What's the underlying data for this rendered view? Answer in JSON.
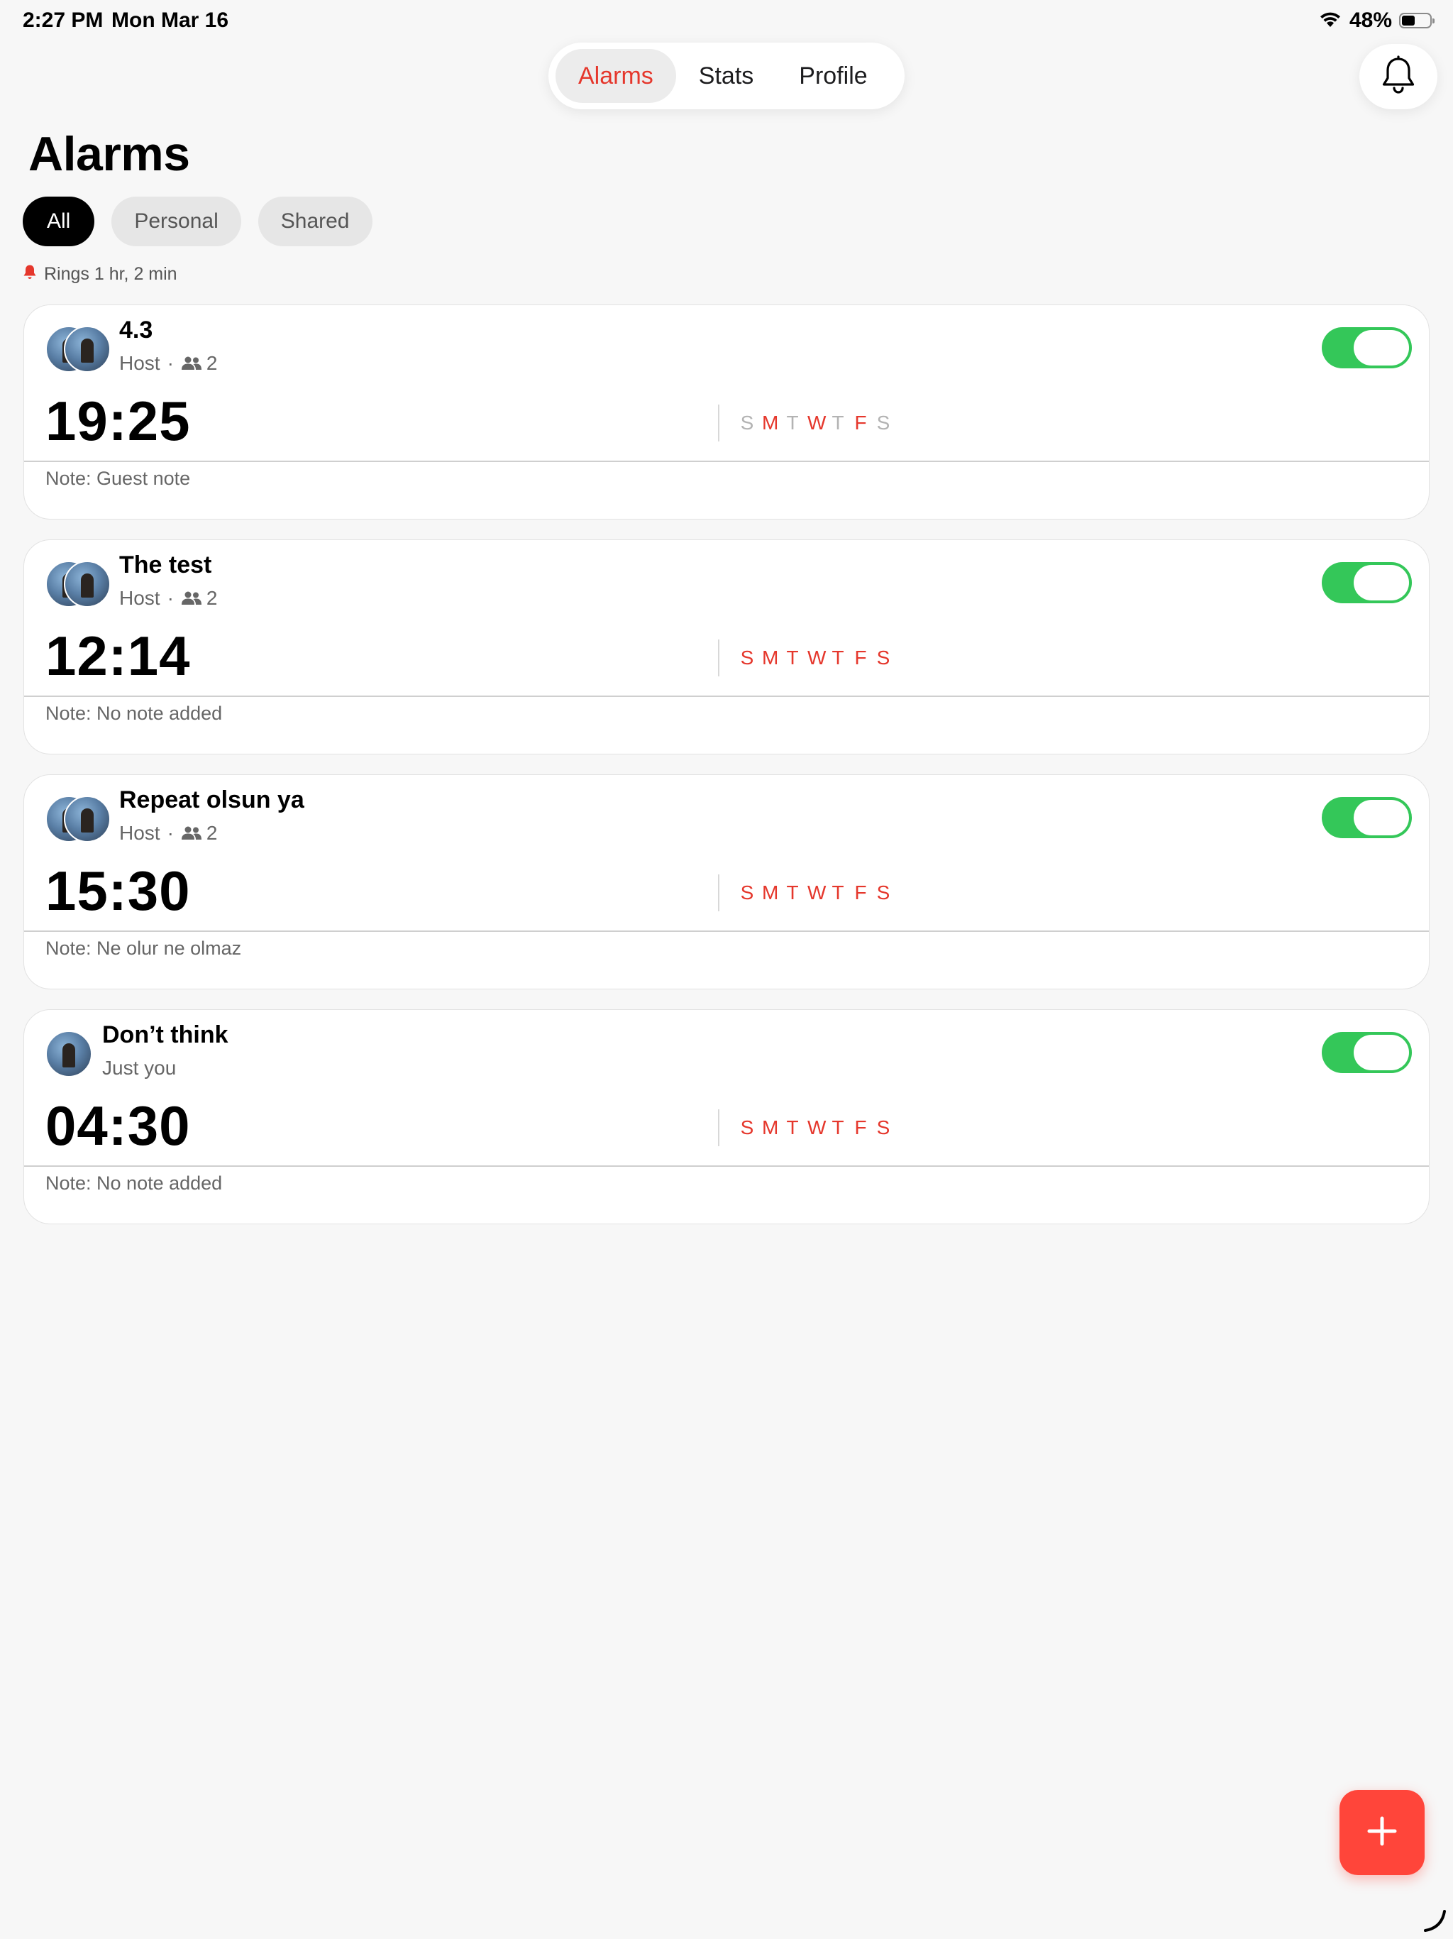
{
  "status_bar": {
    "time": "2:27 PM",
    "date": "Mon Mar 16",
    "battery_pct": "48%",
    "battery_level": 0.48
  },
  "tabs": [
    {
      "label": "Alarms",
      "active": true
    },
    {
      "label": "Stats",
      "active": false
    },
    {
      "label": "Profile",
      "active": false
    }
  ],
  "page_title": "Alarms",
  "filters": [
    {
      "label": "All",
      "active": true
    },
    {
      "label": "Personal",
      "active": false
    },
    {
      "label": "Shared",
      "active": false
    }
  ],
  "next_ring": "Rings 1 hr, 2 min",
  "colors": {
    "accent": "#e5372c",
    "toggle_on": "#34c759",
    "fab": "#ff453a"
  },
  "alarms": [
    {
      "title": "4.3",
      "role": "Host",
      "member_count": "2",
      "time": "19:25",
      "enabled": true,
      "days": [
        {
          "letter": "S",
          "on": false
        },
        {
          "letter": "M",
          "on": true
        },
        {
          "letter": "T",
          "on": false
        },
        {
          "letter": "W",
          "on": true
        },
        {
          "letter": "T",
          "on": false
        },
        {
          "letter": "F",
          "on": true
        },
        {
          "letter": "S",
          "on": false
        }
      ],
      "note": "Note: Guest note"
    },
    {
      "title": "The test",
      "role": "Host",
      "member_count": "2",
      "time": "12:14",
      "enabled": true,
      "days": [
        {
          "letter": "S",
          "on": true
        },
        {
          "letter": "M",
          "on": true
        },
        {
          "letter": "T",
          "on": true
        },
        {
          "letter": "W",
          "on": true
        },
        {
          "letter": "T",
          "on": true
        },
        {
          "letter": "F",
          "on": true
        },
        {
          "letter": "S",
          "on": true
        }
      ],
      "note": "Note: No note added"
    },
    {
      "title": "Repeat olsun ya",
      "role": "Host",
      "member_count": "2",
      "time": "15:30",
      "enabled": true,
      "days": [
        {
          "letter": "S",
          "on": true
        },
        {
          "letter": "M",
          "on": true
        },
        {
          "letter": "T",
          "on": true
        },
        {
          "letter": "W",
          "on": true
        },
        {
          "letter": "T",
          "on": true
        },
        {
          "letter": "F",
          "on": true
        },
        {
          "letter": "S",
          "on": true
        }
      ],
      "note": "Note: Ne olur ne olmaz"
    },
    {
      "title": "Don’t think",
      "role": "Just you",
      "member_count": "",
      "time": "04:30",
      "enabled": true,
      "days": [
        {
          "letter": "S",
          "on": true
        },
        {
          "letter": "M",
          "on": true
        },
        {
          "letter": "T",
          "on": true
        },
        {
          "letter": "W",
          "on": true
        },
        {
          "letter": "T",
          "on": true
        },
        {
          "letter": "F",
          "on": true
        },
        {
          "letter": "S",
          "on": true
        }
      ],
      "note": "Note: No note added"
    }
  ],
  "icons": {
    "bell": "bell-icon",
    "add": "plus-icon",
    "people": "people-icon",
    "wifi": "wifi-icon",
    "battery": "battery-icon",
    "ring": "bell-small-icon"
  }
}
